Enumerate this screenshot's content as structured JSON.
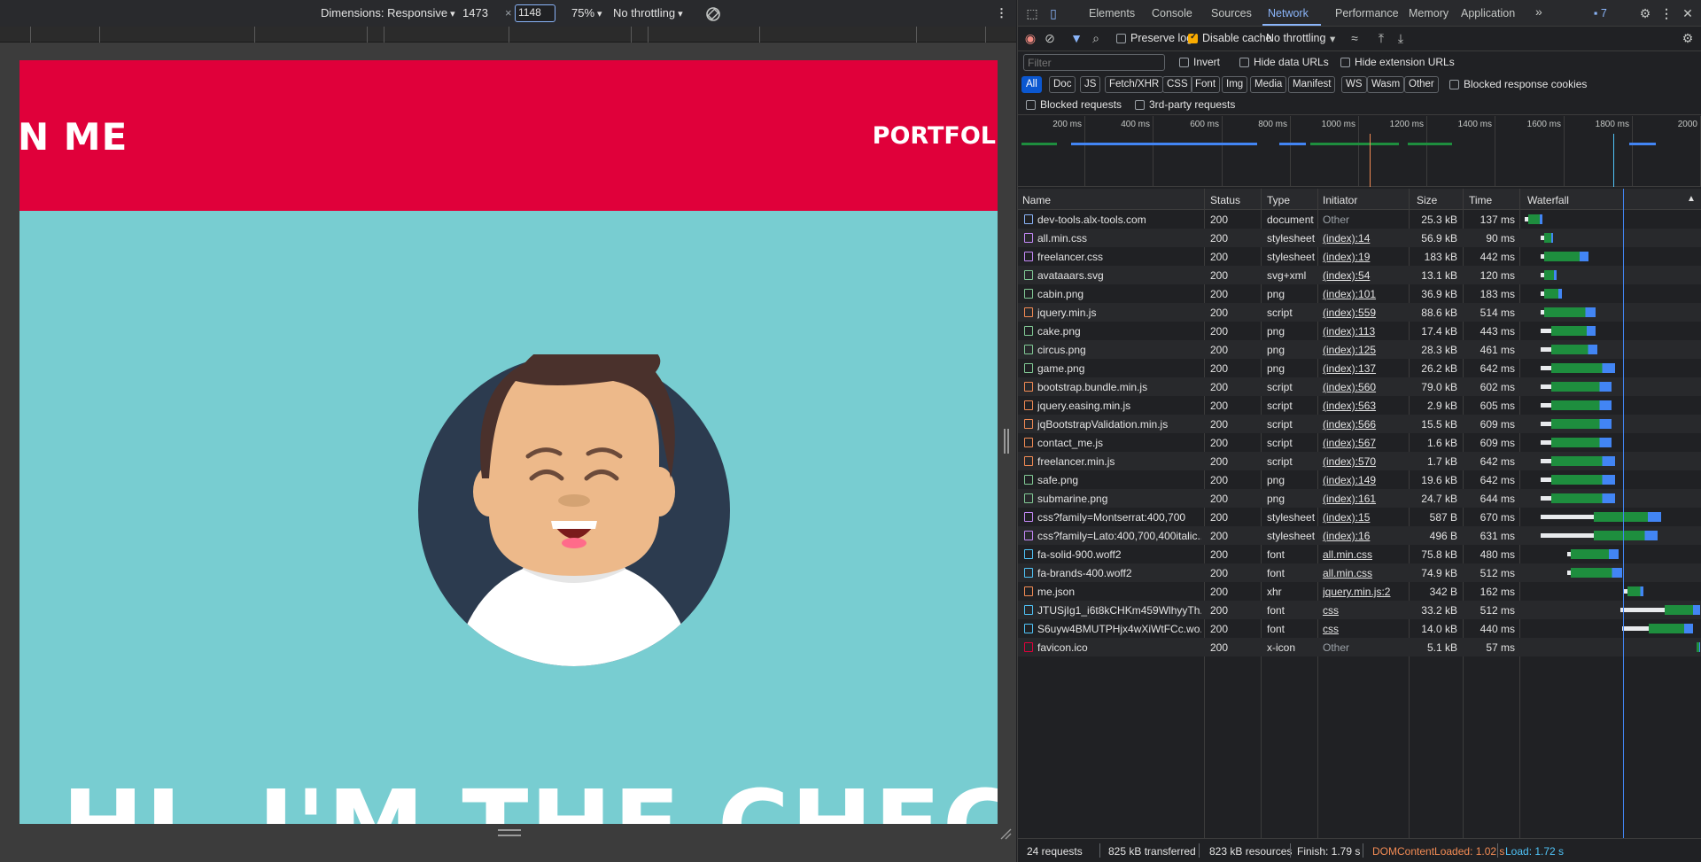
{
  "device_toolbar": {
    "dimensions_label": "Dimensions: Responsive",
    "width_value": "1473",
    "times": "×",
    "height_value": "1148",
    "zoom": "75%",
    "throttling": "No throttling"
  },
  "page": {
    "brand": "N ME",
    "nav_item": "PORTFOL",
    "hero_text": "HI, I'M THE CHECKE"
  },
  "devtools": {
    "tabs": [
      "Elements",
      "Console",
      "Sources",
      "Network",
      "Performance",
      "Memory",
      "Application"
    ],
    "active_tab": "Network",
    "more_tabs": "»",
    "issues_count": "7",
    "toolbar": {
      "preserve_log": "Preserve log",
      "disable_cache": "Disable cache",
      "throttling": "No throttling"
    },
    "filter_placeholder": "Filter",
    "invert": "Invert",
    "hide_data_urls": "Hide data URLs",
    "hide_extension_urls": "Hide extension URLs",
    "type_filters": [
      "All",
      "Doc",
      "JS",
      "Fetch/XHR",
      "CSS",
      "Font",
      "Img",
      "Media",
      "Manifest",
      "WS",
      "Wasm",
      "Other"
    ],
    "blocked_response_cookies": "Blocked response cookies",
    "blocked_requests": "Blocked requests",
    "third_party_requests": "3rd-party requests",
    "timeline_ticks": [
      "200 ms",
      "400 ms",
      "600 ms",
      "800 ms",
      "1000 ms",
      "1200 ms",
      "1400 ms",
      "1600 ms",
      "1800 ms",
      "2000"
    ],
    "columns": [
      "Name",
      "Status",
      "Type",
      "Initiator",
      "Size",
      "Time",
      "Waterfall"
    ],
    "requests": [
      {
        "name": "dev-tools.alx-tools.com",
        "status": "200",
        "type": "document",
        "initiator": "Other",
        "size": "25.3 kB",
        "time": "137 ms",
        "icon": "document-icon",
        "color": "#8ab4f8",
        "wf_start": 0.01,
        "wf_wait": 0.02,
        "wf_len": 0.08
      },
      {
        "name": "all.min.css",
        "status": "200",
        "type": "stylesheet",
        "initiator": "(index):14",
        "size": "56.9 kB",
        "time": "90 ms",
        "icon": "stylesheet-icon",
        "color": "#c58af9",
        "wf_start": 0.1,
        "wf_wait": 0.02,
        "wf_len": 0.05
      },
      {
        "name": "freelancer.css",
        "status": "200",
        "type": "stylesheet",
        "initiator": "(index):19",
        "size": "183 kB",
        "time": "442 ms",
        "icon": "stylesheet-icon",
        "color": "#c58af9",
        "wf_start": 0.1,
        "wf_wait": 0.02,
        "wf_len": 0.25
      },
      {
        "name": "avataaars.svg",
        "status": "200",
        "type": "svg+xml",
        "initiator": "(index):54",
        "size": "13.1 kB",
        "time": "120 ms",
        "icon": "image-icon",
        "color": "#81c995",
        "wf_start": 0.1,
        "wf_wait": 0.02,
        "wf_len": 0.07
      },
      {
        "name": "cabin.png",
        "status": "200",
        "type": "png",
        "initiator": "(index):101",
        "size": "36.9 kB",
        "time": "183 ms",
        "icon": "image-icon",
        "color": "#81c995",
        "wf_start": 0.1,
        "wf_wait": 0.02,
        "wf_len": 0.1
      },
      {
        "name": "jquery.min.js",
        "status": "200",
        "type": "script",
        "initiator": "(index):559",
        "size": "88.6 kB",
        "time": "514 ms",
        "icon": "script-icon",
        "color": "#f28b54",
        "wf_start": 0.1,
        "wf_wait": 0.02,
        "wf_len": 0.29
      },
      {
        "name": "cake.png",
        "status": "200",
        "type": "png",
        "initiator": "(index):113",
        "size": "17.4 kB",
        "time": "443 ms",
        "icon": "image-icon",
        "color": "#81c995",
        "wf_start": 0.1,
        "wf_wait": 0.06,
        "wf_len": 0.25
      },
      {
        "name": "circus.png",
        "status": "200",
        "type": "png",
        "initiator": "(index):125",
        "size": "28.3 kB",
        "time": "461 ms",
        "icon": "image-icon",
        "color": "#81c995",
        "wf_start": 0.1,
        "wf_wait": 0.06,
        "wf_len": 0.26
      },
      {
        "name": "game.png",
        "status": "200",
        "type": "png",
        "initiator": "(index):137",
        "size": "26.2 kB",
        "time": "642 ms",
        "icon": "image-icon",
        "color": "#81c995",
        "wf_start": 0.1,
        "wf_wait": 0.06,
        "wf_len": 0.36
      },
      {
        "name": "bootstrap.bundle.min.js",
        "status": "200",
        "type": "script",
        "initiator": "(index):560",
        "size": "79.0 kB",
        "time": "602 ms",
        "icon": "script-icon",
        "color": "#f28b54",
        "wf_start": 0.1,
        "wf_wait": 0.06,
        "wf_len": 0.34
      },
      {
        "name": "jquery.easing.min.js",
        "status": "200",
        "type": "script",
        "initiator": "(index):563",
        "size": "2.9 kB",
        "time": "605 ms",
        "icon": "script-icon",
        "color": "#f28b54",
        "wf_start": 0.1,
        "wf_wait": 0.06,
        "wf_len": 0.34
      },
      {
        "name": "jqBootstrapValidation.min.js",
        "status": "200",
        "type": "script",
        "initiator": "(index):566",
        "size": "15.5 kB",
        "time": "609 ms",
        "icon": "script-icon",
        "color": "#f28b54",
        "wf_start": 0.1,
        "wf_wait": 0.06,
        "wf_len": 0.34
      },
      {
        "name": "contact_me.js",
        "status": "200",
        "type": "script",
        "initiator": "(index):567",
        "size": "1.6 kB",
        "time": "609 ms",
        "icon": "script-icon",
        "color": "#f28b54",
        "wf_start": 0.1,
        "wf_wait": 0.06,
        "wf_len": 0.34
      },
      {
        "name": "freelancer.min.js",
        "status": "200",
        "type": "script",
        "initiator": "(index):570",
        "size": "1.7 kB",
        "time": "642 ms",
        "icon": "script-icon",
        "color": "#f28b54",
        "wf_start": 0.1,
        "wf_wait": 0.06,
        "wf_len": 0.36
      },
      {
        "name": "safe.png",
        "status": "200",
        "type": "png",
        "initiator": "(index):149",
        "size": "19.6 kB",
        "time": "642 ms",
        "icon": "image-icon",
        "color": "#81c995",
        "wf_start": 0.1,
        "wf_wait": 0.06,
        "wf_len": 0.36
      },
      {
        "name": "submarine.png",
        "status": "200",
        "type": "png",
        "initiator": "(index):161",
        "size": "24.7 kB",
        "time": "644 ms",
        "icon": "image-icon",
        "color": "#81c995",
        "wf_start": 0.1,
        "wf_wait": 0.06,
        "wf_len": 0.36
      },
      {
        "name": "css?family=Montserrat:400,700",
        "status": "200",
        "type": "stylesheet",
        "initiator": "(index):15",
        "size": "587 B",
        "time": "670 ms",
        "icon": "stylesheet-icon",
        "color": "#c58af9",
        "wf_start": 0.1,
        "wf_wait": 0.3,
        "wf_len": 0.38
      },
      {
        "name": "css?family=Lato:400,700,400italic...",
        "status": "200",
        "type": "stylesheet",
        "initiator": "(index):16",
        "size": "496 B",
        "time": "631 ms",
        "icon": "stylesheet-icon",
        "color": "#c58af9",
        "wf_start": 0.1,
        "wf_wait": 0.3,
        "wf_len": 0.36
      },
      {
        "name": "fa-solid-900.woff2",
        "status": "200",
        "type": "font",
        "initiator": "all.min.css",
        "size": "75.8 kB",
        "time": "480 ms",
        "icon": "font-icon",
        "color": "#4fc3f7",
        "wf_start": 0.25,
        "wf_wait": 0.02,
        "wf_len": 0.27
      },
      {
        "name": "fa-brands-400.woff2",
        "status": "200",
        "type": "font",
        "initiator": "all.min.css",
        "size": "74.9 kB",
        "time": "512 ms",
        "icon": "font-icon",
        "color": "#4fc3f7",
        "wf_start": 0.25,
        "wf_wait": 0.02,
        "wf_len": 0.29
      },
      {
        "name": "me.json",
        "status": "200",
        "type": "xhr",
        "initiator": "jquery.min.js:2",
        "size": "342 B",
        "time": "162 ms",
        "icon": "xhr-icon",
        "color": "#f28b54",
        "wf_start": 0.57,
        "wf_wait": 0.02,
        "wf_len": 0.09
      },
      {
        "name": "JTUSjIg1_i6t8kCHKm459WlhyyTh...",
        "status": "200",
        "type": "font",
        "initiator": "css",
        "size": "33.2 kB",
        "time": "512 ms",
        "icon": "font-icon",
        "color": "#4fc3f7",
        "wf_start": 0.55,
        "wf_wait": 0.25,
        "wf_len": 0.29
      },
      {
        "name": "S6uyw4BMUTPHjx4wXiWtFCc.wo...",
        "status": "200",
        "type": "font",
        "initiator": "css",
        "size": "14.0 kB",
        "time": "440 ms",
        "icon": "font-icon",
        "color": "#4fc3f7",
        "wf_start": 0.56,
        "wf_wait": 0.15,
        "wf_len": 0.25
      },
      {
        "name": "favicon.ico",
        "status": "200",
        "type": "x-icon",
        "initiator": "Other",
        "size": "5.1 kB",
        "time": "57 ms",
        "icon": "favicon-icon",
        "color": "#e0003a",
        "wf_start": 0.98,
        "wf_wait": 0.0,
        "wf_len": 0.02
      }
    ],
    "status_bar": {
      "requests": "24 requests",
      "transferred": "825 kB transferred",
      "resources": "823 kB resources",
      "finish": "Finish: 1.79 s",
      "dom_content_loaded": "DOMContentLoaded: 1.02 s",
      "load": "Load: 1.72 s"
    },
    "colors": {
      "accent": "#8ab4f8",
      "dcl": "#f28b54",
      "load": "#4fc3f7",
      "waterfall_green": "#1e8e3e",
      "waterfall_blue": "#4285f4"
    }
  }
}
